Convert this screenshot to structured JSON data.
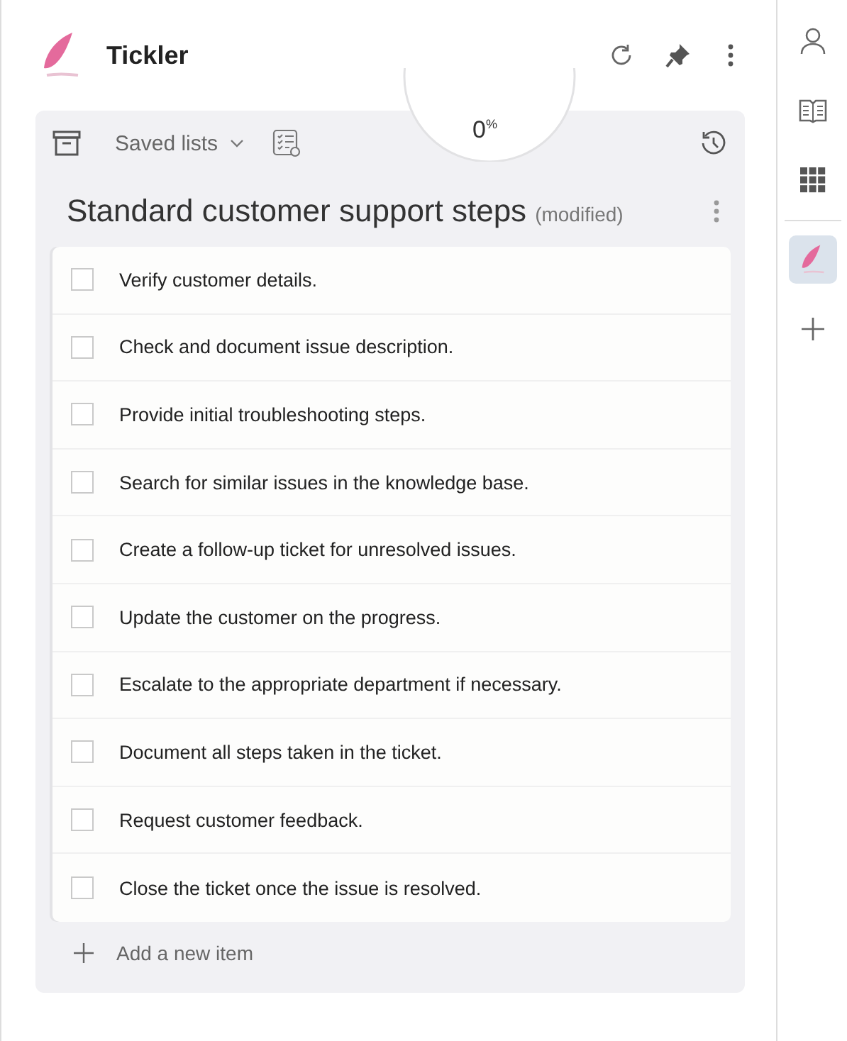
{
  "app": {
    "title": "Tickler"
  },
  "toolbar": {
    "saved_lists": "Saved lists"
  },
  "progress": {
    "level": 0,
    "reading": "0$^{%}$"
  },
  "list": {
    "title": "Standard customer support steps",
    "status": "(modified)",
    "items": [
      {
        "text": "Verify customer details.",
        "checked": false
      },
      {
        "text": "Check and document issue description.",
        "checked": false
      },
      {
        "text": "Provide initial troubleshooting steps.",
        "checked": false
      },
      {
        "text": "Search for similar issues in the knowledge base.",
        "checked": false
      },
      {
        "text": "Create a follow-up ticket for unresolved issues.",
        "checked": false
      },
      {
        "text": "Update the customer on the progress.",
        "checked": false
      },
      {
        "text": "Escalate to the appropriate department if necessary.",
        "checked": false
      },
      {
        "text": "Document all steps taken in the ticket.",
        "checked": false
      },
      {
        "text": "Request customer feedback.",
        "checked": false
      },
      {
        "text": "Close the ticket once the issue is resolved.",
        "checked": false
      }
    ],
    "add_item": "Add a new item"
  },
  "sidebar": {
    "apps": [
      {
        "kind": "person",
        "selected": false
      },
      {
        "kind": "book",
        "selected": false
      },
      {
        "kind": "grid",
        "selected": false
      }
    ],
    "tools": [
      {
        "kind": "feather",
        "selected": true
      },
      {
        "kind": "plus",
        "selected": false
      }
    ]
  }
}
